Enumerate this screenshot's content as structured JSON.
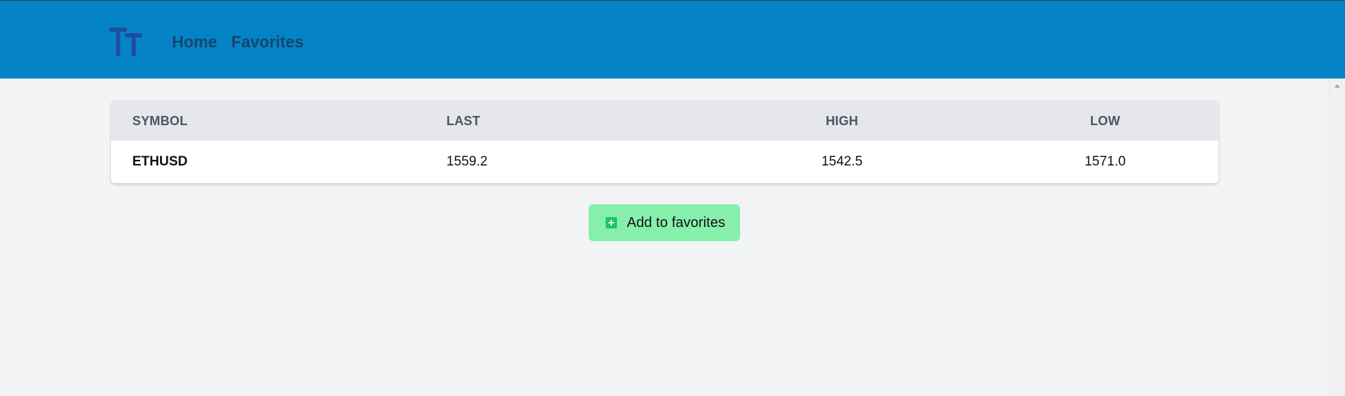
{
  "header": {
    "logo_icon": "tt-logo-icon",
    "nav": [
      {
        "label": "Home"
      },
      {
        "label": "Favorites"
      }
    ],
    "background": "#0484c7"
  },
  "table": {
    "columns": [
      "SYMBOL",
      "LAST",
      "HIGH",
      "LOW"
    ],
    "rows": [
      {
        "symbol": "ETHUSD",
        "last": "1559.2",
        "high": "1542.5",
        "low": "1571.0"
      }
    ]
  },
  "actions": {
    "add_favorite_label": "Add to favorites",
    "add_favorite_icon": "plus-square-icon",
    "button_color": "#86efac"
  }
}
